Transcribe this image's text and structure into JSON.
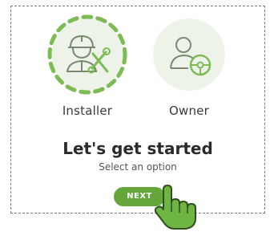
{
  "options": [
    {
      "label": "Installer",
      "icon": "installer-icon",
      "selected": true
    },
    {
      "label": "Owner",
      "icon": "owner-icon",
      "selected": false
    }
  ],
  "heading": "Let's get started",
  "subheading": "Select an option",
  "next_button": {
    "label": "NEXT"
  },
  "colors": {
    "accent": "#64a63a",
    "circle_bg": "#eef3ea",
    "icon_stroke": "#7a8a70",
    "icon_accent": "#7dbb55"
  },
  "pointer_icon": "hand-pointer-icon"
}
